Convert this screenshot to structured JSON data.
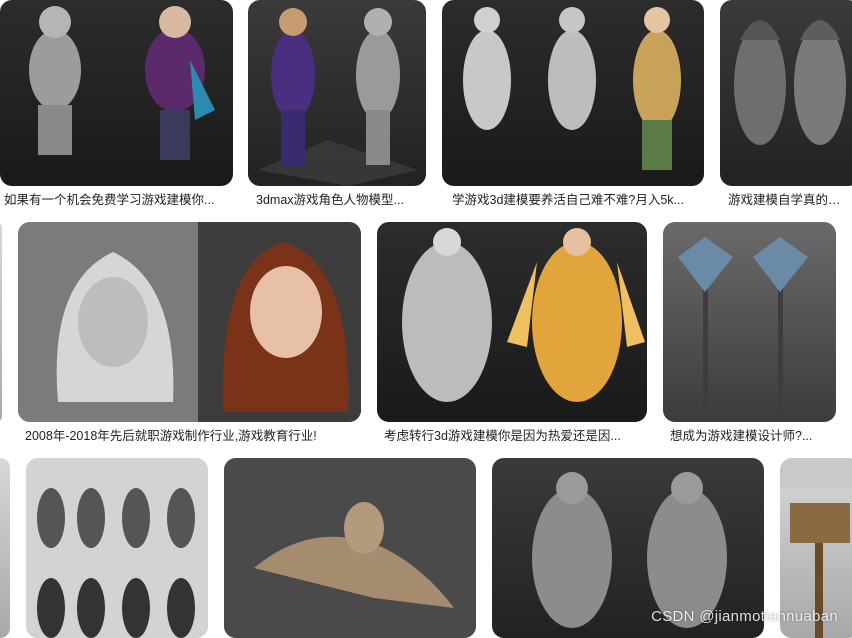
{
  "results": {
    "row1": [
      {
        "caption": "如果有一个机会免费学习游戏建模你..."
      },
      {
        "caption": "3dmax游戏角色人物模型..."
      },
      {
        "caption": "学游戏3d建模要养活自己难不难?月入5k..."
      },
      {
        "caption": "游戏建模自学真的能..."
      }
    ],
    "row2": [
      {
        "caption": "2008年-2018年先后就职游戏制作行业,游戏教育行业!"
      },
      {
        "caption": "考虑转行3d游戏建模你是因为热爱还是因..."
      },
      {
        "caption": "想成为游戏建模设计师?..."
      }
    ]
  },
  "watermark": "CSDN @jianmotiannuaban"
}
